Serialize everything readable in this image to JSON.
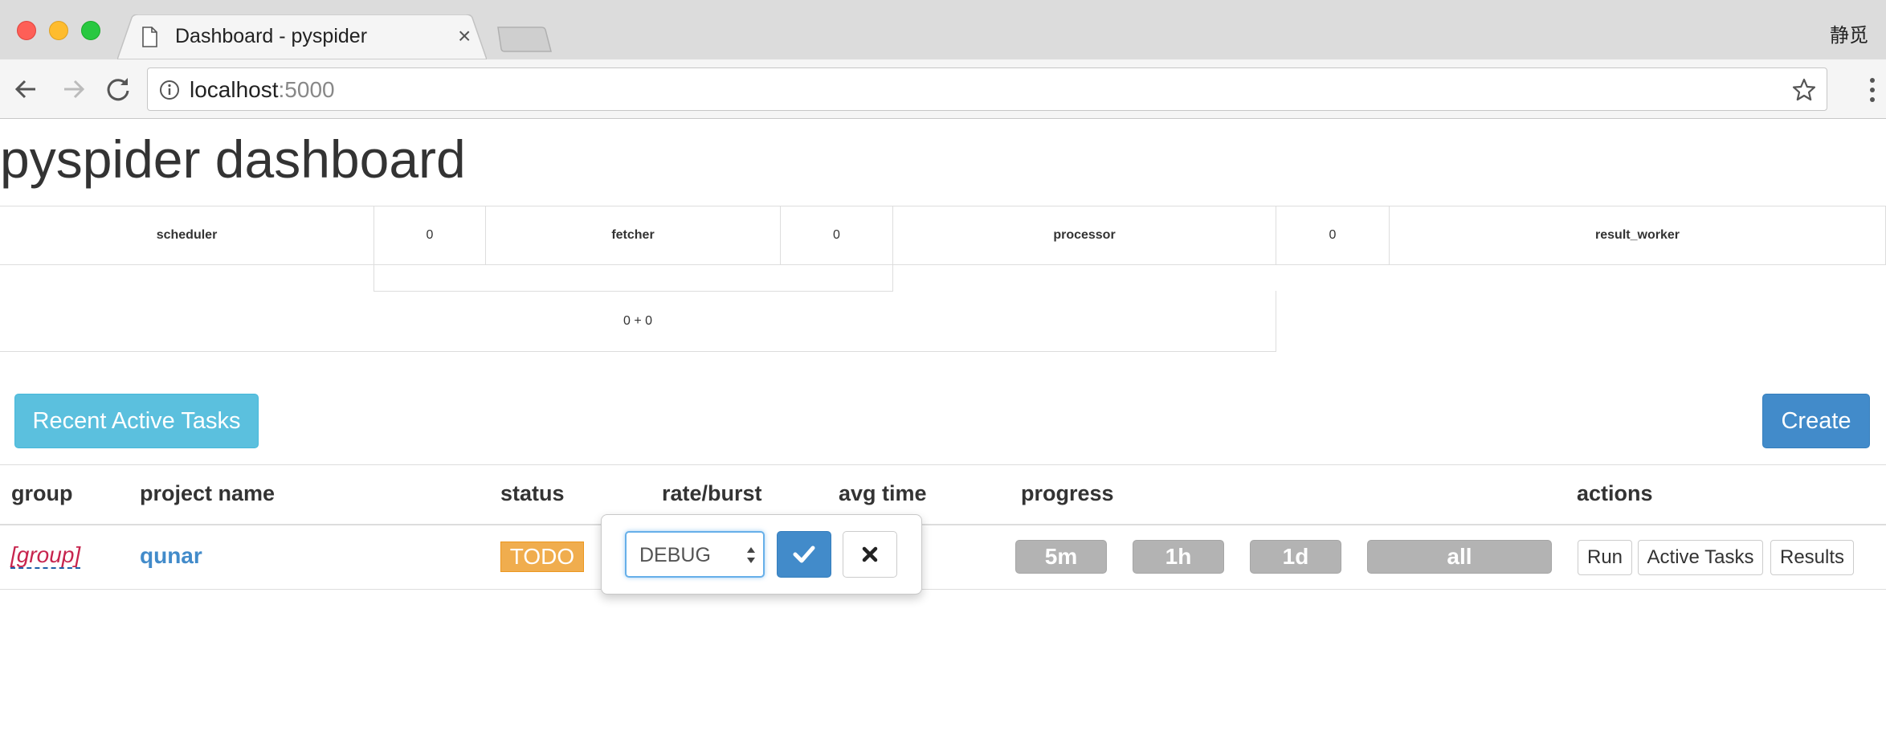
{
  "browser": {
    "tab_title": "Dashboard - pyspider",
    "profile_name": "静觅",
    "url_host": "localhost",
    "url_port": ":5000"
  },
  "page": {
    "title": "pyspider dashboard"
  },
  "stats": {
    "scheduler_label": "scheduler",
    "scheduler_value": "0",
    "fetcher_label": "fetcher",
    "fetcher_value": "0",
    "processor_label": "processor",
    "processor_value": "0",
    "result_worker_label": "result_worker",
    "summary": "0 + 0"
  },
  "buttons": {
    "recent_active_tasks": "Recent Active Tasks",
    "create": "Create"
  },
  "table": {
    "headers": {
      "group": "group",
      "project_name": "project name",
      "status": "status",
      "rate_burst": "rate/burst",
      "avg_time": "avg time",
      "progress": "progress",
      "actions": "actions"
    },
    "rows": [
      {
        "group": "[group]",
        "project_name": "qunar",
        "status": "TODO",
        "progress": [
          "5m",
          "1h",
          "1d",
          "all"
        ],
        "actions": [
          "Run",
          "Active Tasks",
          "Results"
        ]
      }
    ]
  },
  "status_editor": {
    "selected": "DEBUG"
  },
  "colors": {
    "info": "#5bc0de",
    "primary": "#428bca",
    "warning": "#f0ad4e",
    "group_text": "#c7254e",
    "progress_bg": "#b3b3b3"
  }
}
